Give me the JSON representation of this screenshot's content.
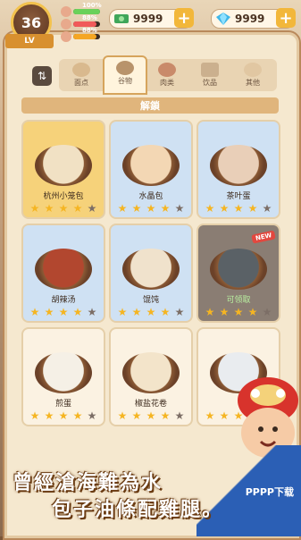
{
  "level": {
    "value": "36",
    "label": "LV"
  },
  "stats": [
    {
      "pct": "100%",
      "fill": 1.0,
      "color": "#6ad15a",
      "icon": "heart-face-icon"
    },
    {
      "pct": "88%",
      "fill": 0.88,
      "color": "#f05a5a",
      "icon": "chef-face-icon"
    },
    {
      "pct": "88%",
      "fill": 0.88,
      "color": "#f5a623",
      "icon": "customer-face-icon"
    }
  ],
  "currency": {
    "cash": {
      "amount": "9999",
      "icon": "cash-icon"
    },
    "diamond": {
      "amount": "9999",
      "icon": "diamond-icon"
    }
  },
  "sort_icon": "⇅",
  "tabs": [
    {
      "label": "面点",
      "icon": "bread-icon"
    },
    {
      "label": "谷物",
      "icon": "rice-bowl-icon",
      "active": true
    },
    {
      "label": "肉类",
      "icon": "meat-icon"
    },
    {
      "label": "饮品",
      "icon": "drink-icon"
    },
    {
      "label": "其他",
      "icon": "egg-icon"
    }
  ],
  "unlock_label": "解鎖",
  "cards": [
    {
      "name": "杭州小笼包",
      "stars": 4,
      "bg": "#f6d27a"
    },
    {
      "name": "水晶包",
      "stars": 4,
      "bg": "#cfe1f3"
    },
    {
      "name": "茶叶蛋",
      "stars": 4,
      "bg": "#cfe1f3"
    },
    {
      "name": "胡辣汤",
      "stars": 4,
      "bg": "#cfe1f3"
    },
    {
      "name": "馄饨",
      "stars": 4,
      "bg": "#cfe1f3"
    },
    {
      "name": "可领取",
      "stars": 4,
      "bg": "#8a7d73",
      "badge": "NEW"
    },
    {
      "name": "煎蛋",
      "stars": 4,
      "bg": "#fbf2e2"
    },
    {
      "name": "椒盐花卷",
      "stars": 4,
      "bg": "#fbf2e2"
    },
    {
      "name": "",
      "stars": 4,
      "bg": "#fbf2e2"
    }
  ],
  "slogan": {
    "line1": "曾經滄海難為水",
    "line2": "包子油條配雞腿。"
  },
  "watermark": "PPPP下载"
}
